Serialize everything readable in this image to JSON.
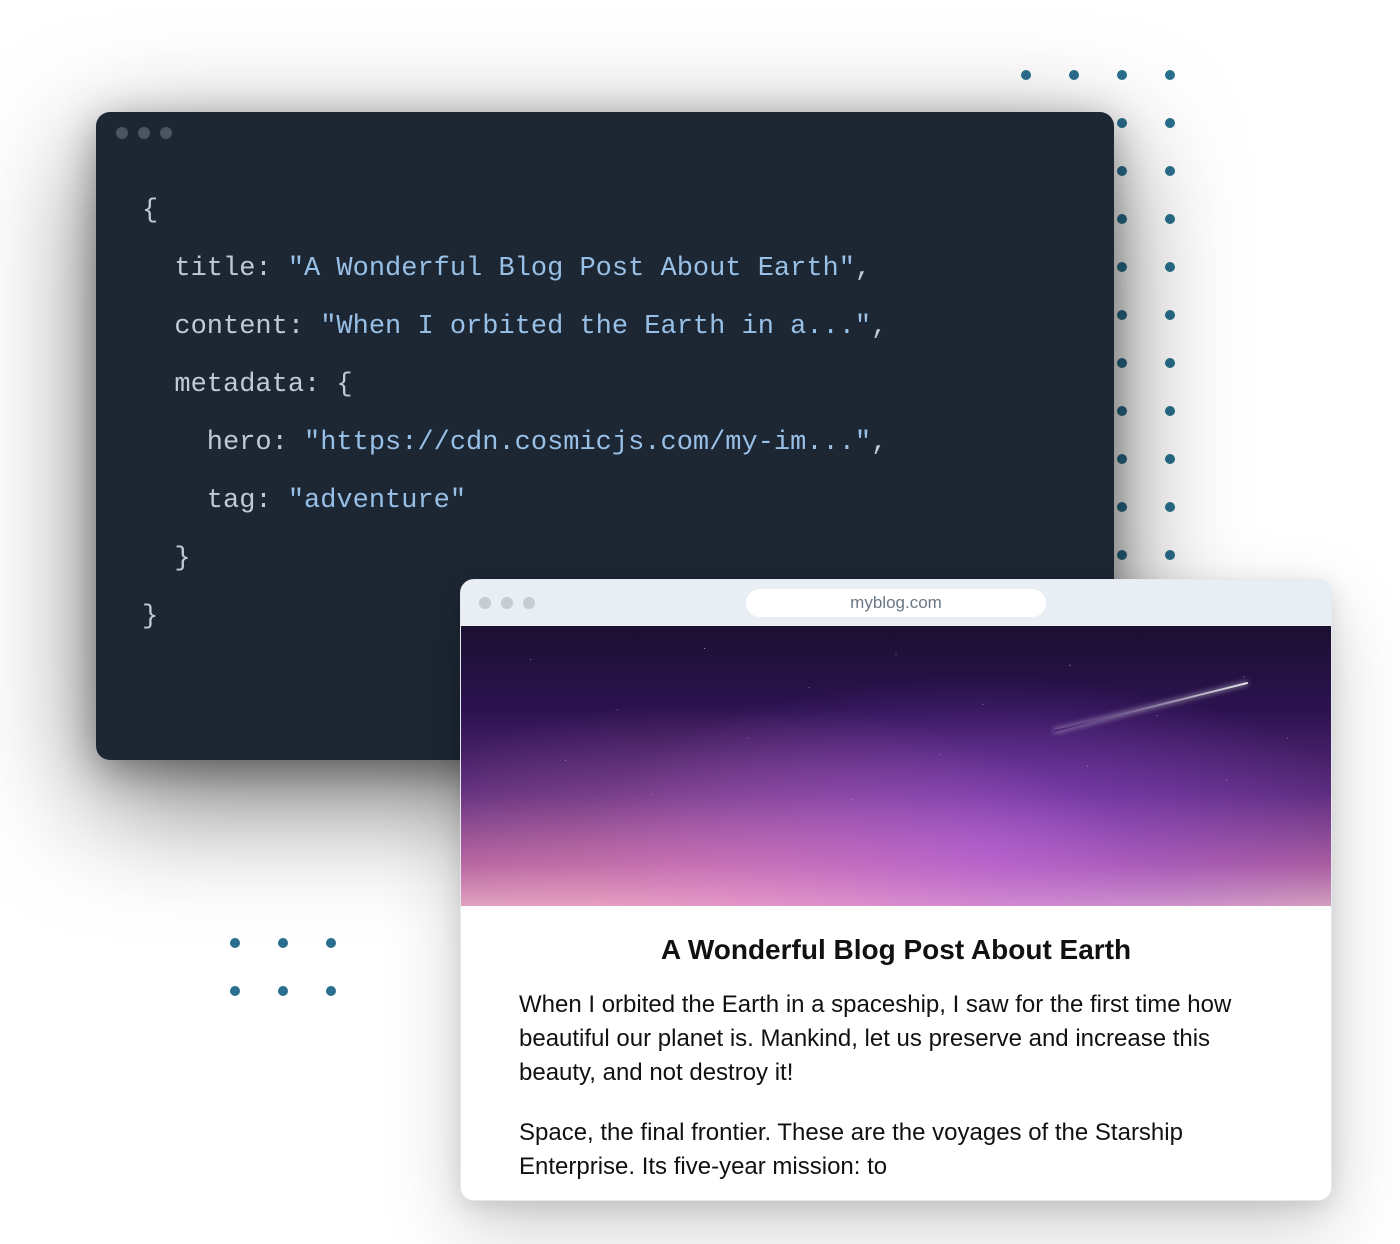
{
  "code": {
    "l1": "{",
    "l2a": "  title: ",
    "l2b": "\"A Wonderful Blog Post About Earth\"",
    "l2c": ",",
    "l3a": "  content: ",
    "l3b": "\"When I orbited the Earth in a...\"",
    "l3c": ",",
    "l4": "  metadata: {",
    "l5a": "    hero: ",
    "l5b": "\"https://cdn.cosmicjs.com/my-im...\"",
    "l5c": ",",
    "l6a": "    tag: ",
    "l6b": "\"adventure\"",
    "l7": "  }",
    "l8": "}"
  },
  "browser": {
    "url": "myblog.com",
    "title": "A Wonderful Blog Post About Earth",
    "para1": "When I orbited the Earth in a spaceship, I saw for the first time how beautiful our planet is. Mankind, let us preserve and increase this beauty, and not destroy it!",
    "para2": "Space, the final frontier. These are the voyages of the Starship Enterprise. Its five-year mission: to"
  }
}
